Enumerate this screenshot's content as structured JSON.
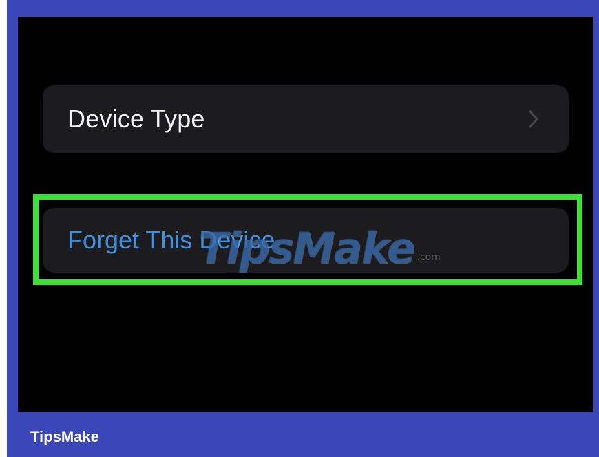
{
  "settings": {
    "device_type_label": "Device Type",
    "forget_label": "Forget This Device"
  },
  "watermark": {
    "text": "TipsMake",
    "suffix": ".com"
  },
  "footer": {
    "brand": "TipsMake"
  },
  "icons": {
    "chevron": "chevron-right-icon"
  },
  "colors": {
    "frame": "#3b46b8",
    "highlight": "#3fe03a",
    "destructive_link": "#3f8fe0",
    "cell_bg": "#1c1c1e"
  }
}
